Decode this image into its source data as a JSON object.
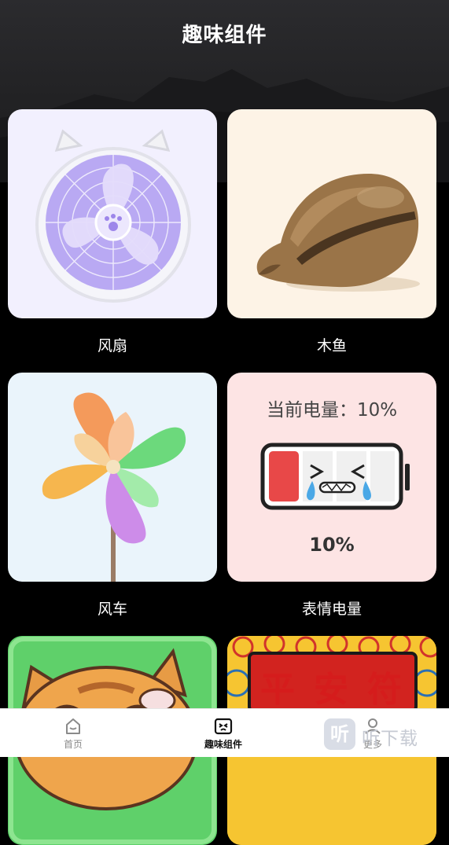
{
  "header": {
    "title": "趣味组件"
  },
  "cards": [
    {
      "label": "风扇",
      "bg": "#f2f0fe"
    },
    {
      "label": "木鱼",
      "bg": "#fdf3e6"
    },
    {
      "label": "风车",
      "bg": "#eaf4fb"
    },
    {
      "label": "表情电量",
      "bg": "#fde4e4",
      "battery_title": "当前电量：10%",
      "battery_value": "10%",
      "level": 0.1
    },
    {
      "label": "",
      "bg": "#5fd06a"
    },
    {
      "label": "",
      "bg": "#f6c531",
      "chars": [
        "平",
        "安",
        "符"
      ]
    }
  ],
  "tabbar": {
    "items": [
      {
        "label": "首页",
        "icon": "home-icon",
        "active": false
      },
      {
        "label": "趣味组件",
        "icon": "widget-icon",
        "active": true
      },
      {
        "label": "更多",
        "icon": "user-icon",
        "active": false
      }
    ]
  },
  "watermark": {
    "glyph": "听",
    "text": "听下载"
  }
}
